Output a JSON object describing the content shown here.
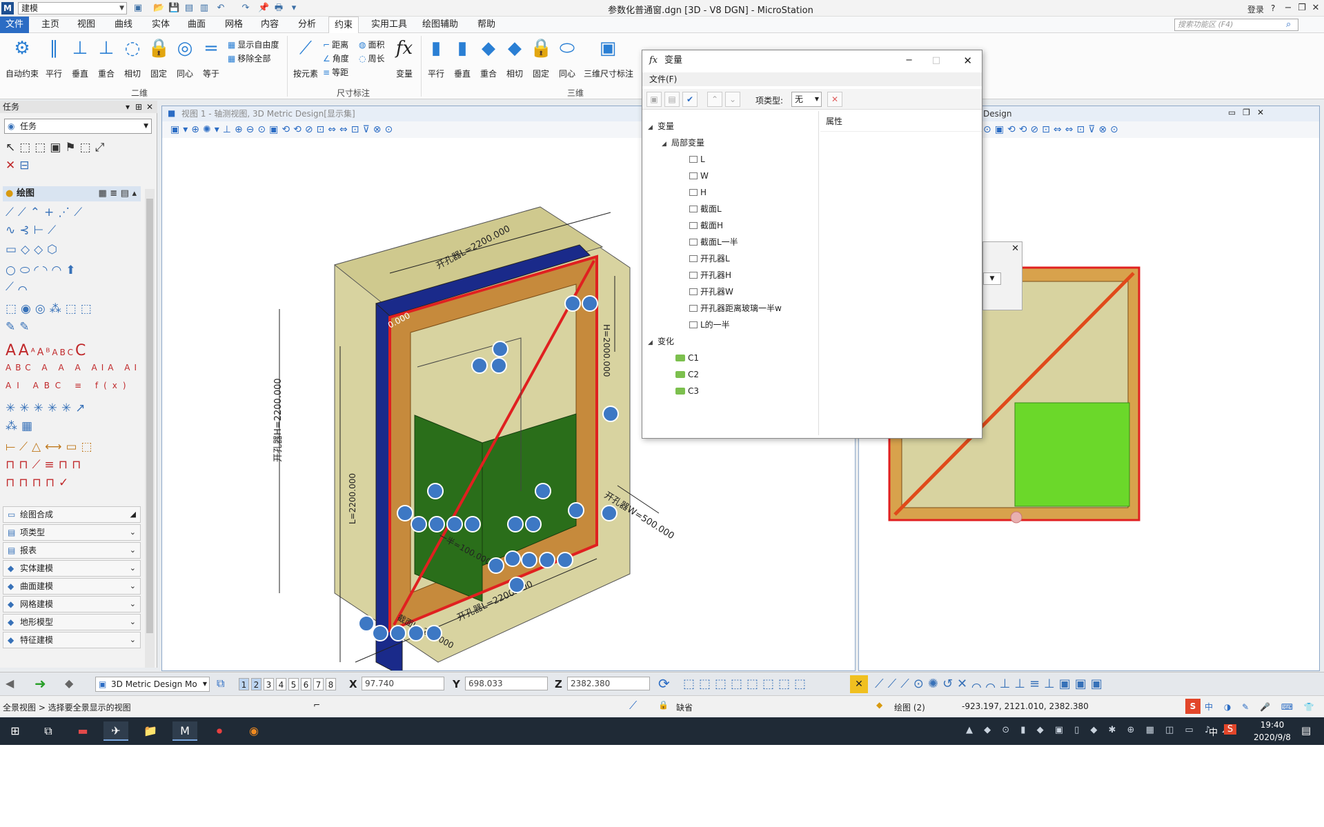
{
  "titlebar": {
    "workflow": "建模",
    "title": "参数化普通窗.dgn [3D - V8 DGN] - MicroStation",
    "login": "登录",
    "help": "?"
  },
  "menu": {
    "tabs": [
      "文件",
      "主页",
      "视图",
      "曲线",
      "实体",
      "曲面",
      "网格",
      "内容",
      "分析",
      "约束",
      "实用工具",
      "绘图辅助",
      "帮助"
    ],
    "active": "约束",
    "search_placeholder": "搜索功能区 (F4)"
  },
  "ribbon": {
    "group_2d": "二维",
    "group_dim": "尺寸标注",
    "group_3d": "三维",
    "btn_auto": "自动约束",
    "btn_parallel": "平行",
    "btn_perp": "垂直",
    "btn_coincident": "重合",
    "btn_tangent": "相切",
    "btn_fix": "固定",
    "btn_concentric": "同心",
    "btn_equal": "等于",
    "small_show_dof": "显示自由度",
    "small_remove_all": "移除全部",
    "btn_by_element": "按元素",
    "small_distance": "距离",
    "small_angle": "角度",
    "small_equal_dist": "等距",
    "small_area": "面积",
    "small_perimeter": "周长",
    "btn_variables": "变量",
    "btn3d_parallel": "平行",
    "btn3d_perp": "垂直",
    "btn3d_coincident": "重合",
    "btn3d_tangent": "相切",
    "btn3d_fix": "固定",
    "btn3d_concentric": "同心",
    "btn3d_dim": "三维尺寸标注"
  },
  "taskpanel": {
    "header": "任务",
    "task": "任务",
    "draw_section": "绘图",
    "sections": [
      "绘图合成",
      "项类型",
      "报表",
      "实体建模",
      "曲面建模",
      "网格建模",
      "地形模型",
      "特征建模"
    ]
  },
  "view1": {
    "title": "视图 1 - 轴测视图, 3D Metric Design[显示集]",
    "dims": {
      "top_len": "开孔器L=2200.000",
      "left_h": "开孔器H=2200.000",
      "inner_h": "L=2200.000",
      "right_h": "H=2000.000",
      "w": "开孔器W=500.000",
      "bottom_len": "开孔器L=2200.000",
      "section": "截面L=200.000",
      "half": "一半=100.000",
      "zero": "0.000"
    }
  },
  "view2": {
    "title": "Design"
  },
  "var_dialog": {
    "title": "变量",
    "menu_file": "文件(F)",
    "type_label": "项类型:",
    "type_value": "无",
    "props_header": "属性",
    "root": "变量",
    "local": "局部变量",
    "vars": [
      "L",
      "W",
      "H",
      "截面L",
      "截面H",
      "截面L一半",
      "开孔器L",
      "开孔器H",
      "开孔器W",
      "开孔器距离玻璃一半w",
      "L的一半"
    ],
    "variations_label": "变化",
    "variations": [
      "C1",
      "C2",
      "C3"
    ]
  },
  "statusbar": {
    "model": "3D Metric Design Mo",
    "views": [
      "1",
      "2",
      "3",
      "4",
      "5",
      "6",
      "7",
      "8"
    ],
    "x_label": "X",
    "x_value": "97.740",
    "y_label": "Y",
    "y_value": "698.033",
    "z_label": "Z",
    "z_value": "2382.380",
    "prompt": "全景视图 > 选择要全景显示的视图",
    "lock_label": "缺省",
    "level": "绘图 (2)",
    "readout": "-923.197, 2121.010, 2382.380"
  },
  "taskbar": {
    "time": "19:40",
    "date": "2020/9/8",
    "ime": "中"
  },
  "colors": {
    "accent": "#2b6cc4",
    "frame_red": "#e02020",
    "glass_green": "#2a6e1a",
    "wall_tan": "#d8d3a0",
    "wood": "#c68a3c",
    "blue_bar": "#1a2a8a"
  }
}
